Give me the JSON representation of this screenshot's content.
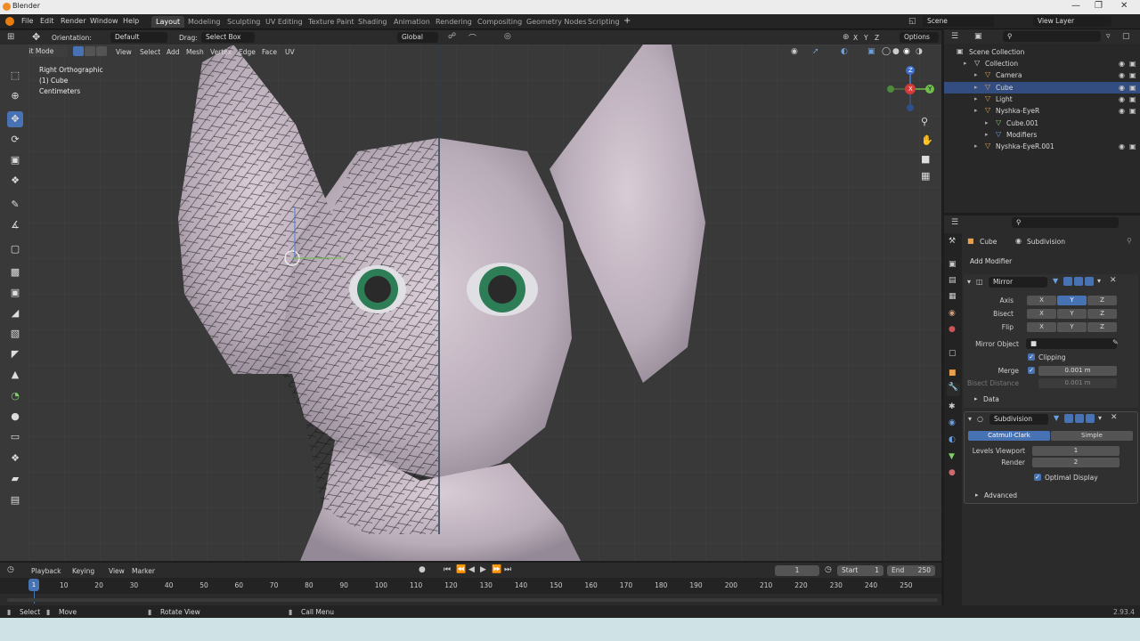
{
  "app": {
    "title": "Blender",
    "version": "2.93.4"
  },
  "menu": [
    "File",
    "Edit",
    "Render",
    "Window",
    "Help"
  ],
  "workspaces": [
    "Layout",
    "Modeling",
    "Sculpting",
    "UV Editing",
    "Texture Paint",
    "Shading",
    "Animation",
    "Rendering",
    "Compositing",
    "Geometry Nodes",
    "Scripting"
  ],
  "add_workspace": "+",
  "scene": {
    "name": "Scene",
    "view_layer": "View Layer"
  },
  "tool_header": {
    "orientation_label": "Orientation:",
    "orientation_value": "Default",
    "drag_label": "Drag:",
    "drag_value": "Select Box",
    "transform_orientation": "Global",
    "options": "Options"
  },
  "viewport_header": {
    "mode": "Edit Mode",
    "menus": [
      "View",
      "Select",
      "Add",
      "Mesh",
      "Vertex",
      "Edge",
      "Face",
      "UV"
    ]
  },
  "viewport_overlay": {
    "view": "Right Orthographic",
    "object": "(1) Cube",
    "units": "Centimeters"
  },
  "gizmo": {
    "x": "X",
    "y": "Y",
    "z": "Z"
  },
  "axis_locks": [
    "X",
    "Y",
    "Z"
  ],
  "timeline": {
    "menus": [
      "Playback",
      "Keying",
      "View",
      "Marker"
    ],
    "current_frame": "1",
    "start_label": "Start",
    "start": "1",
    "end_label": "End",
    "end": "250",
    "playhead": "1",
    "ticks": [
      "10",
      "20",
      "30",
      "40",
      "50",
      "60",
      "70",
      "80",
      "90",
      "100",
      "110",
      "120",
      "130",
      "140",
      "150",
      "160",
      "170",
      "180",
      "190",
      "200",
      "210",
      "220",
      "230",
      "240",
      "250"
    ]
  },
  "statusbar": {
    "select": "Select",
    "move": "Move",
    "rotate": "Rotate View",
    "call_menu": "Call Menu"
  },
  "outliner": {
    "root": "Scene Collection",
    "items": [
      {
        "name": "Collection",
        "depth": 0,
        "selected": false
      },
      {
        "name": "Camera",
        "depth": 1,
        "selected": false
      },
      {
        "name": "Cube",
        "depth": 1,
        "selected": true
      },
      {
        "name": "Light",
        "depth": 1,
        "selected": false
      },
      {
        "name": "Nyshka-EyeR",
        "depth": 1,
        "selected": false
      },
      {
        "name": "Cube.001",
        "depth": 2,
        "selected": false
      },
      {
        "name": "Modifiers",
        "depth": 2,
        "selected": false
      },
      {
        "name": "Nyshka-EyeR.001",
        "depth": 1,
        "selected": false
      }
    ]
  },
  "properties": {
    "object": "Cube",
    "modifier_tab": "Subdivision",
    "add_modifier": "Add Modifier",
    "mirror": {
      "name": "Mirror",
      "axis_label": "Axis",
      "bisect_label": "Bisect",
      "flip_label": "Flip",
      "axis_buttons": [
        "X",
        "Y",
        "Z"
      ],
      "axis_active": "Y",
      "mirror_object_label": "Mirror Object",
      "clipping_label": "Clipping",
      "merge_label": "Merge",
      "merge_value": "0.001 m",
      "bisect_distance_label": "Bisect Distance",
      "bisect_distance_value": "0.001 m",
      "data_label": "Data"
    },
    "subdivision": {
      "name": "Subdivision",
      "types": [
        "Catmull-Clark",
        "Simple"
      ],
      "active_type": "Catmull-Clark",
      "levels_viewport_label": "Levels Viewport",
      "levels_viewport": "1",
      "render_label": "Render",
      "render": "2",
      "optimal_display_label": "Optimal Display",
      "advanced_label": "Advanced"
    }
  },
  "colors": {
    "accent": "#4772b3",
    "header": "#2b2b2b",
    "viewport": "#393939",
    "selected_row": "#334d80"
  }
}
